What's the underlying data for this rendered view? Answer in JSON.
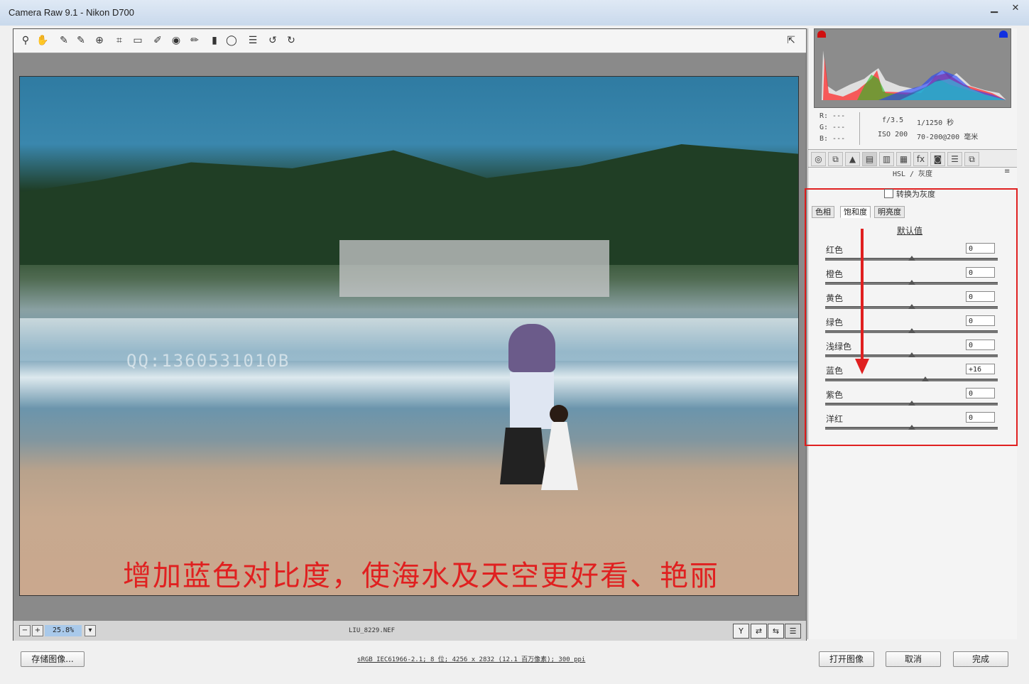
{
  "window": {
    "title": "Camera Raw 9.1 -  Nikon D700"
  },
  "toolbar": {
    "tools": [
      {
        "name": "zoom-tool",
        "glyph": "⚲"
      },
      {
        "name": "hand-tool",
        "glyph": "✋"
      },
      {
        "name": "white-balance-tool",
        "glyph": "✎"
      },
      {
        "name": "color-sampler-tool",
        "glyph": "✎"
      },
      {
        "name": "targeted-adjustment-tool",
        "glyph": "⊕"
      },
      {
        "name": "crop-tool",
        "glyph": "⌗"
      },
      {
        "name": "straighten-tool",
        "glyph": "▭"
      },
      {
        "name": "spot-removal-tool",
        "glyph": "✐"
      },
      {
        "name": "red-eye-tool",
        "glyph": "◉"
      },
      {
        "name": "adjustment-brush-tool",
        "glyph": "✏"
      },
      {
        "name": "graduated-filter-tool",
        "glyph": "▮"
      },
      {
        "name": "radial-filter-tool",
        "glyph": "◯"
      },
      {
        "name": "preferences-icon",
        "glyph": "☰"
      },
      {
        "name": "rotate-left-icon",
        "glyph": "↺"
      },
      {
        "name": "rotate-right-icon",
        "glyph": "↻"
      }
    ],
    "fullscreen_glyph": "⇱"
  },
  "image": {
    "caption": "增加蓝色对比度，使海水及天空更好看、艳丽",
    "watermark": "QQ:1360531010B"
  },
  "status": {
    "zoom": "25.8%",
    "filename": "LIU_8229.NEF",
    "zoom_out": "−",
    "zoom_in": "+",
    "dropdown": "▾",
    "view_buttons": [
      "Y",
      "⇄",
      "⇆",
      "☰"
    ]
  },
  "info": {
    "r": "R:  ---",
    "g": "G:  ---",
    "b": "B:  ---",
    "aperture": "f/3.5",
    "shutter": "1/1250 秒",
    "iso": "ISO 200",
    "lens": "70-200@200 毫米"
  },
  "panel": {
    "tabs": [
      "◎",
      "⧉",
      "▲",
      "▤",
      "▥",
      "▦",
      "fx",
      "◙",
      "☰",
      "⧉"
    ],
    "title": "HSL / 灰度",
    "menu_glyph": "≡",
    "grayscale_label": "转换为灰度",
    "subtabs": [
      "色相",
      "饱和度",
      "明亮度"
    ],
    "default_label": "默认值",
    "sliders": [
      {
        "label": "红色",
        "value": "0",
        "level": 0
      },
      {
        "label": "橙色",
        "value": "0",
        "level": 0
      },
      {
        "label": "黄色",
        "value": "0",
        "level": 0
      },
      {
        "label": "绿色",
        "value": "0",
        "level": 0
      },
      {
        "label": "浅绿色",
        "value": "0",
        "level": 0
      },
      {
        "label": "蓝色",
        "value": "+16",
        "level": 16
      },
      {
        "label": "紫色",
        "value": "0",
        "level": 0
      },
      {
        "label": "洋红",
        "value": "0",
        "level": 0
      }
    ]
  },
  "bottom": {
    "save_label": "存储图像...",
    "workflow": "sRGB IEC61966-2.1; 8 位; 4256 x 2832 (12.1 百万像素); 300 ppi",
    "open_label": "打开图像",
    "cancel_label": "取消",
    "done_label": "完成"
  },
  "colors": {
    "accent_red": "#e02020",
    "zoom_highlight": "#a9c9ea"
  }
}
